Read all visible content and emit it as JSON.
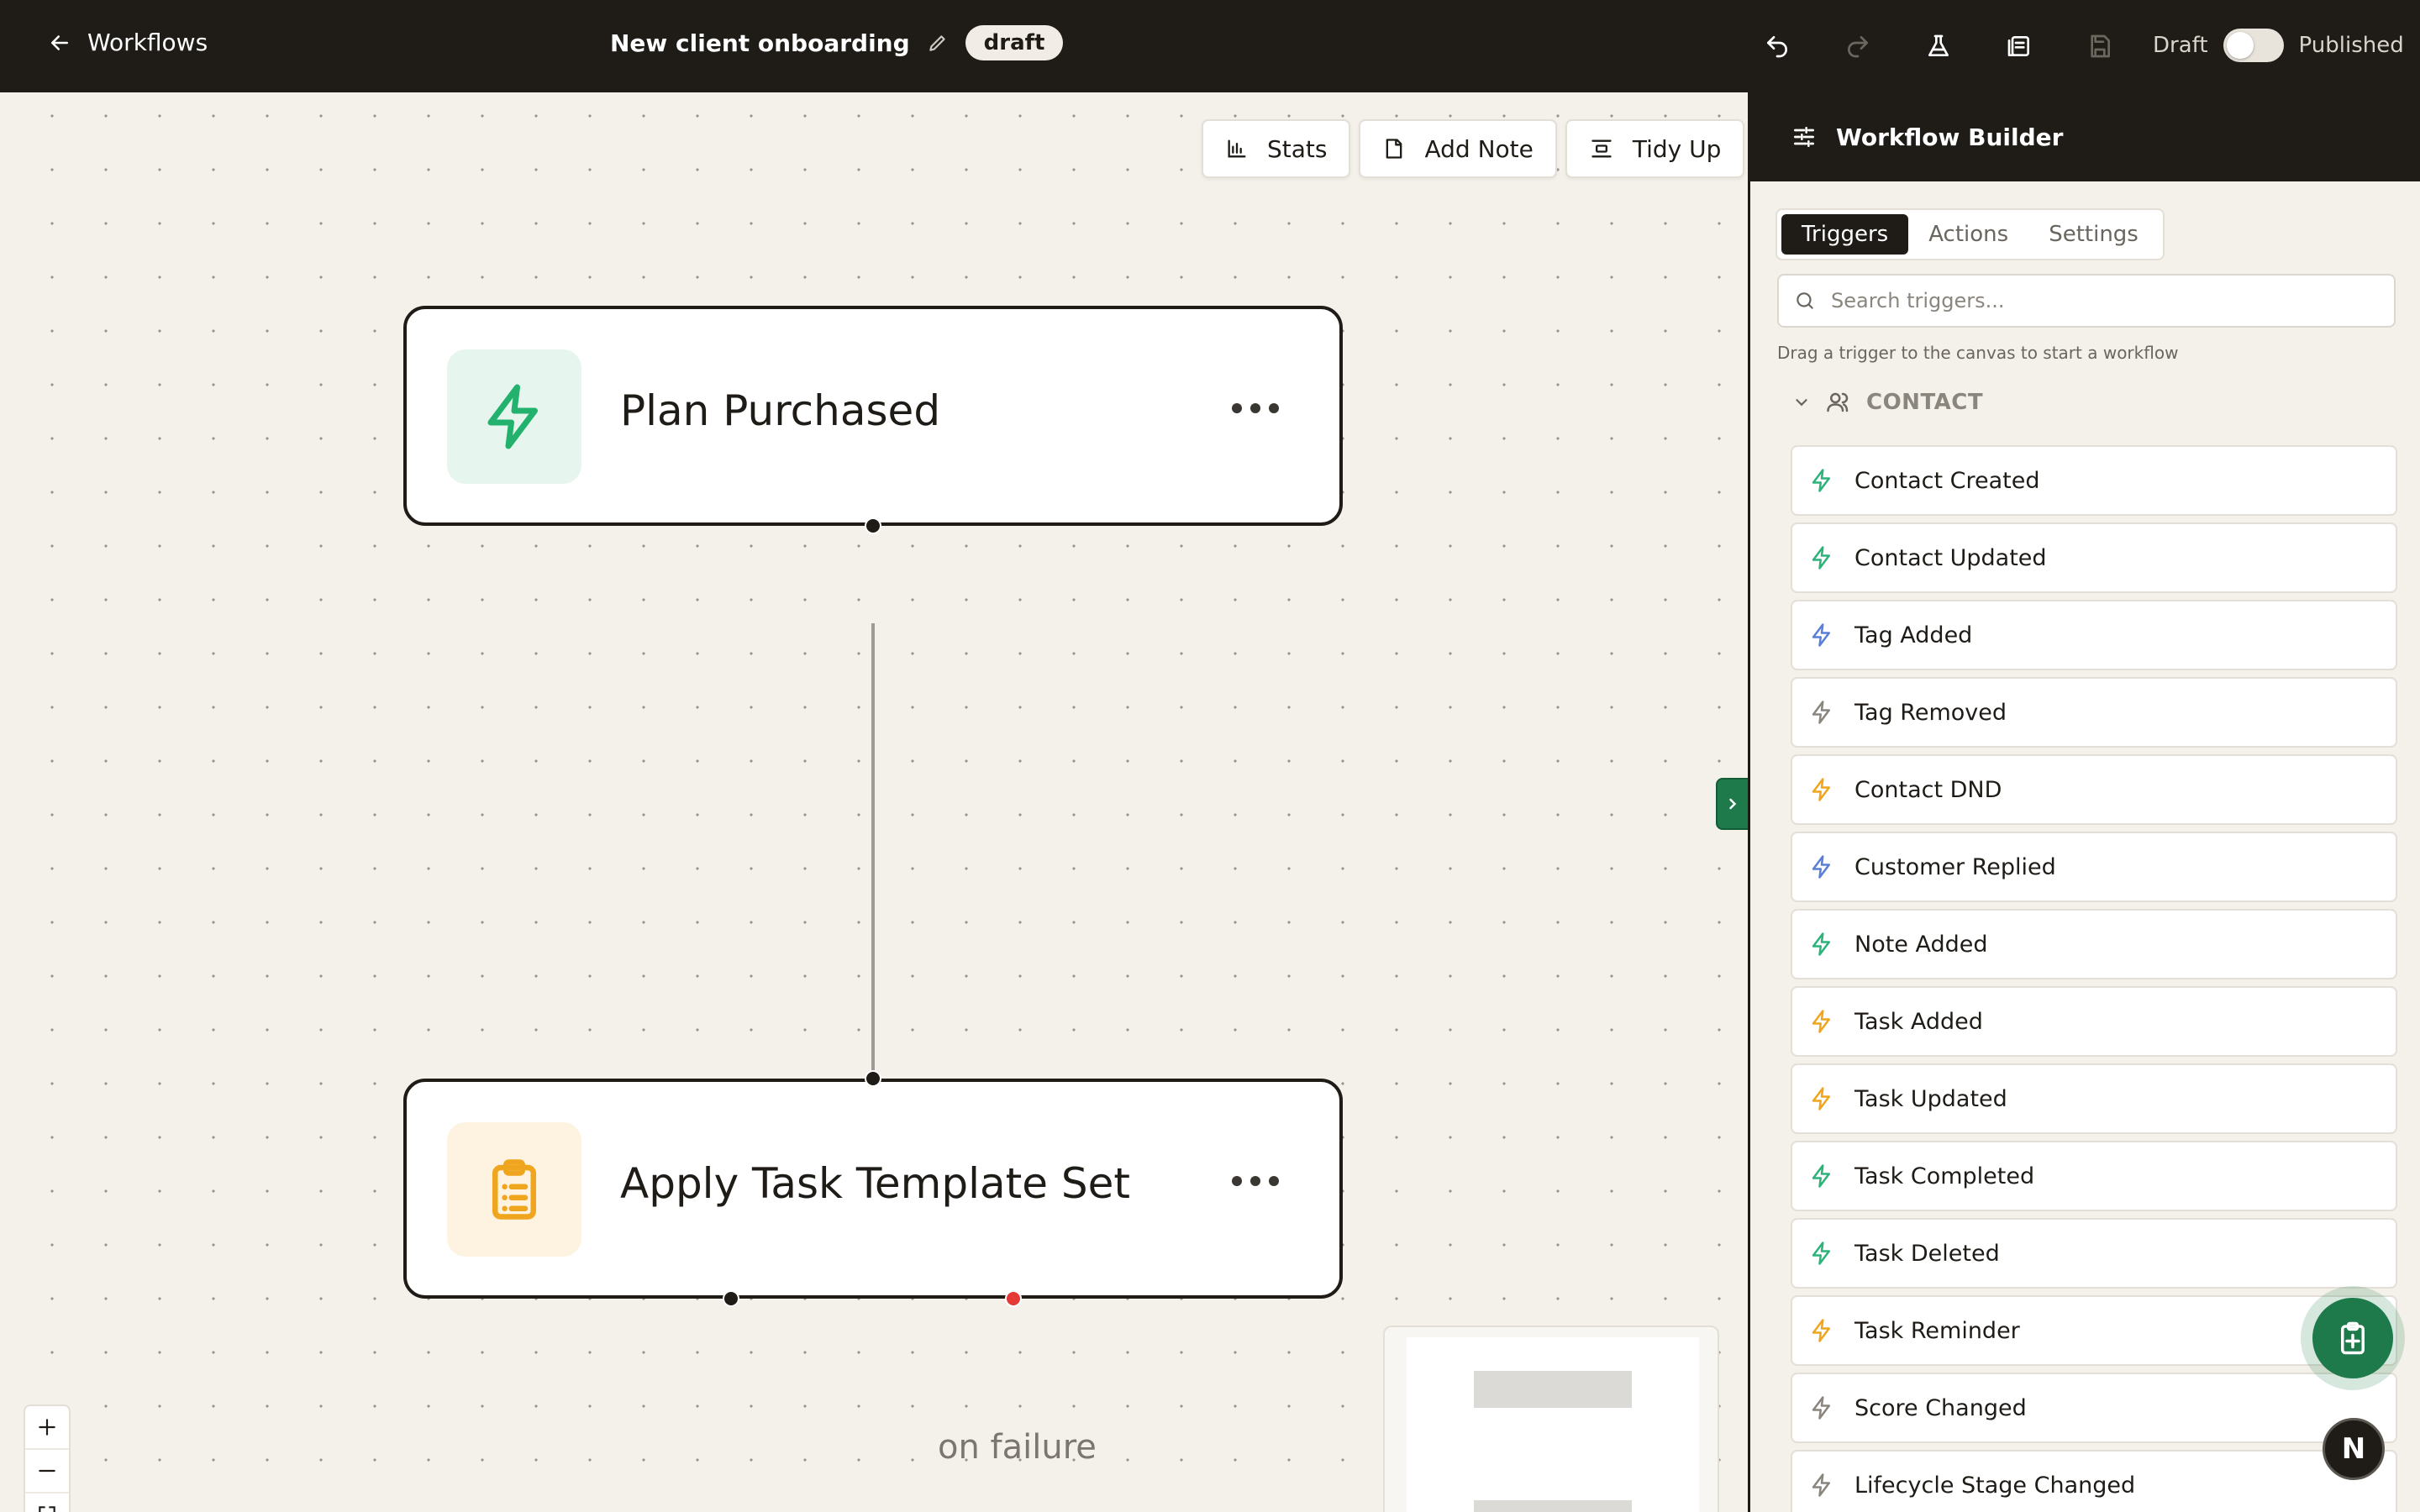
{
  "topbar": {
    "back_label": "Workflows",
    "workflow_title": "New client onboarding",
    "status_badge": "draft",
    "mode_left": "Draft",
    "mode_right": "Published",
    "toggle_state": "draft"
  },
  "canvas": {
    "tools": [
      {
        "label": "Stats",
        "icon": "bar-chart-icon"
      },
      {
        "label": "Add Note",
        "icon": "note-icon"
      },
      {
        "label": "Tidy Up",
        "icon": "align-icon"
      }
    ],
    "nodes": [
      {
        "label": "Plan Purchased",
        "icon": "lightning-icon",
        "color": "#23b26d"
      },
      {
        "label": "Apply Task Template Set",
        "icon": "clipboard-icon",
        "color": "#f0a51e"
      }
    ],
    "failure_label": "on failure"
  },
  "panel": {
    "title": "Workflow Builder",
    "tabs": [
      "Triggers",
      "Actions",
      "Settings"
    ],
    "active_tab": "Triggers",
    "search_placeholder": "Search triggers...",
    "hint": "Drag a trigger to the canvas to start a workflow",
    "section_title": "CONTACT",
    "triggers": [
      {
        "label": "Contact Created",
        "color": "#2db37a"
      },
      {
        "label": "Contact Updated",
        "color": "#2db37a"
      },
      {
        "label": "Tag Added",
        "color": "#5b7fd8"
      },
      {
        "label": "Tag Removed",
        "color": "#8a857d"
      },
      {
        "label": "Contact DND",
        "color": "#f0a51e"
      },
      {
        "label": "Customer Replied",
        "color": "#5b7fd8"
      },
      {
        "label": "Note Added",
        "color": "#2db37a"
      },
      {
        "label": "Task Added",
        "color": "#f0a51e"
      },
      {
        "label": "Task Updated",
        "color": "#f0a51e"
      },
      {
        "label": "Task Completed",
        "color": "#2db37a"
      },
      {
        "label": "Task Deleted",
        "color": "#2db37a"
      },
      {
        "label": "Task Reminder",
        "color": "#f0a51e"
      },
      {
        "label": "Score Changed",
        "color": "#8a857d"
      },
      {
        "label": "Lifecycle Stage Changed",
        "color": "#8a857d"
      }
    ]
  },
  "avatar_letter": "N",
  "colors": {
    "accent": "#1e7a4a",
    "dark": "#1f1c17",
    "failure_port": "#e53935"
  }
}
